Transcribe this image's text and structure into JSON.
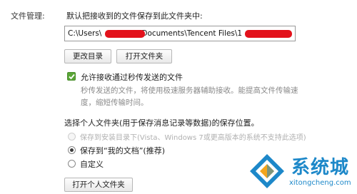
{
  "file_management": {
    "section_label": "文件管理:",
    "description": "默认把接收到的文件保存到此文件夹中:",
    "path": {
      "segment_1": "C:\\Users\\",
      "segment_2": "Documents\\Tencent Files\\1",
      "segment_3": "\\"
    },
    "buttons": {
      "change_dir": "更改目录",
      "open_folder": "打开文件夹"
    },
    "allow_transfer": {
      "checked": true,
      "label": "允许接收通过秒传发送的文件",
      "hint_line1": "秒传发送的文件，将使用极速服务器辅助接收。能提高文件传输速",
      "hint_line2": "度，缩短传输时间。"
    }
  },
  "personal_folder": {
    "heading": "选择个人文件夹(用于保存消息记录等数据)的保存位置。",
    "options": [
      {
        "label": "保存到安装目录下(Vista、Windows 7或更高版本的系统不支持此选项)",
        "selected": false,
        "disabled": true
      },
      {
        "label": "保存到“我的文档”(推荐)",
        "selected": true,
        "disabled": false
      },
      {
        "label": "自定义",
        "selected": false,
        "disabled": false
      }
    ],
    "open_button": "打开个人文件夹"
  },
  "watermark": {
    "brand": "系统城",
    "domain": "xitongcheng.com",
    "color": "#1d88c9"
  },
  "colors": {
    "checkbox": "#5aa537",
    "redaction": "#e3121b"
  }
}
